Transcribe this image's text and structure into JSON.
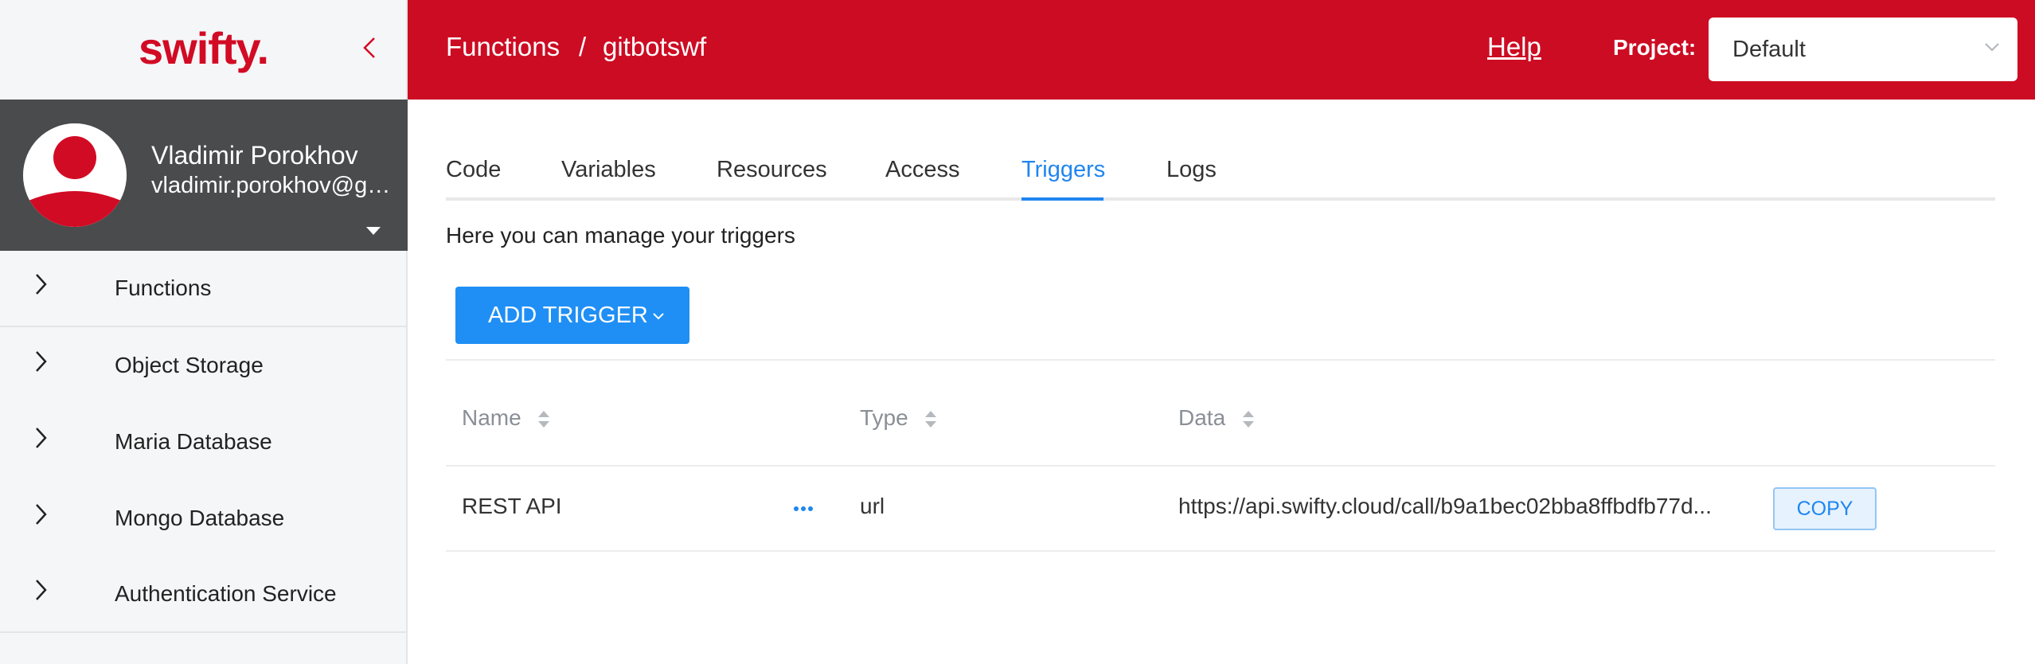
{
  "brand": {
    "logo": "swifty.",
    "accent": "#cc0c23",
    "link": "#1f86f0"
  },
  "user": {
    "name": "Vladimir Porokhov",
    "email": "vladimir.porokhov@gmail.com"
  },
  "nav": {
    "items": [
      {
        "label": "Functions"
      },
      {
        "label": "Object Storage"
      },
      {
        "label": "Maria Database"
      },
      {
        "label": "Mongo Database"
      },
      {
        "label": "Authentication Service"
      }
    ]
  },
  "header": {
    "breadcrumb": {
      "root": "Functions",
      "separator": "/",
      "current": "gitbotswf"
    },
    "help": "Help",
    "project_label": "Project:",
    "project_value": "Default"
  },
  "tabs": [
    {
      "label": "Code"
    },
    {
      "label": "Variables"
    },
    {
      "label": "Resources"
    },
    {
      "label": "Access"
    },
    {
      "label": "Triggers",
      "active": true
    },
    {
      "label": "Logs"
    }
  ],
  "triggers": {
    "intro": "Here you can manage your triggers",
    "add_button": "ADD TRIGGER",
    "columns": {
      "name": "Name",
      "type": "Type",
      "data": "Data"
    },
    "rows": [
      {
        "name": "REST API",
        "type": "url",
        "data": "https://api.swifty.cloud/call/b9a1bec02bba8ffbdfb77d...",
        "copy_label": "COPY"
      }
    ]
  }
}
